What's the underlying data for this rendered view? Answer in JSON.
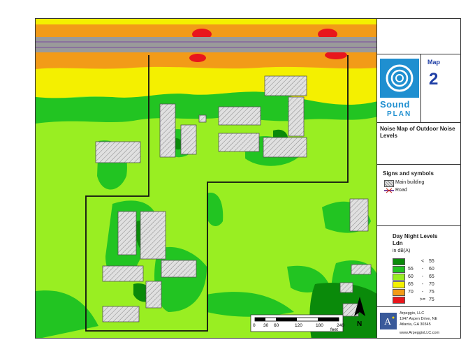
{
  "map_number_label": "Map",
  "map_number": "2",
  "brand": {
    "word1": "Sound",
    "word2": "PLAN"
  },
  "map_title": "Noise Map of Outdoor Noise Levels",
  "signs": {
    "heading": "Signs and symbols",
    "items": [
      {
        "label": "Main building"
      },
      {
        "label": "Road"
      }
    ]
  },
  "levels": {
    "heading": "Day Night Levels",
    "subheading": "Ldn",
    "unit": "in dB(A)",
    "rows": [
      {
        "op": "",
        "low": "",
        "sep": "<",
        "high": "55",
        "color": "#0a8a0a"
      },
      {
        "op": "",
        "low": "55",
        "sep": "-",
        "high": "60",
        "color": "#22c422"
      },
      {
        "op": "",
        "low": "60",
        "sep": "-",
        "high": "65",
        "color": "#99ee22"
      },
      {
        "op": "",
        "low": "65",
        "sep": "-",
        "high": "70",
        "color": "#f4f000"
      },
      {
        "op": "",
        "low": "70",
        "sep": "-",
        "high": "75",
        "color": "#f29b18"
      },
      {
        "op": "",
        "low": "",
        "sep": ">=",
        "high": "75",
        "color": "#e8161c"
      }
    ]
  },
  "scale": {
    "ticks": [
      "0",
      "30",
      "60",
      "120",
      "180",
      "240"
    ],
    "unit": "feet"
  },
  "north": "N",
  "company": {
    "name": "Arpeggio, LLC",
    "address1": "1947 Aspen Drive, NE",
    "address2": "Atlanta, GA 30345",
    "web": "www.ArpeggioLLC.com"
  }
}
